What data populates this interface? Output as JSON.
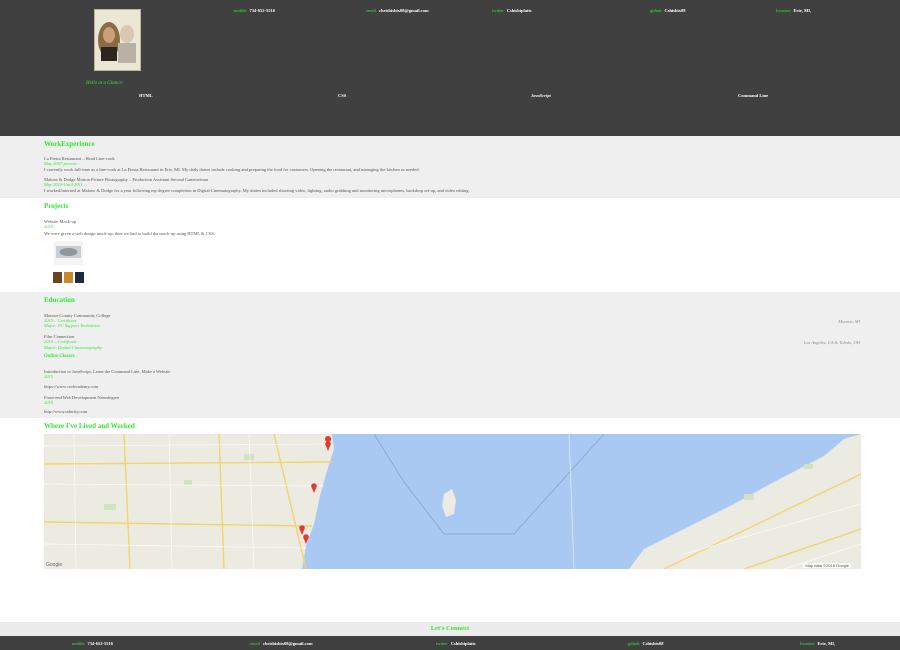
{
  "header": {
    "contacts": [
      {
        "label": "mobile",
        "value": "734-652-5516"
      },
      {
        "label": "email",
        "value": "chrisbishix08@gmail.com"
      },
      {
        "label": "twitter",
        "value": "Cshisbiplatis"
      },
      {
        "label": "github",
        "value": "Cshishix08"
      },
      {
        "label": "location",
        "value": "Erie, MI,"
      }
    ],
    "hello": "Hello at a Glance:",
    "skills": [
      "HTML",
      "CSS",
      "JavaScript",
      "Command Line"
    ]
  },
  "work": {
    "title": "WorkExperience",
    "jobs": [
      {
        "role": "La Fiesta Restaurant – Head Line-cook",
        "dates": "May 2007-present",
        "desc": "I currently work full-time as a line-cook at La Fiesta Restaurant in Erie, MI. My daily duties include cooking and preparing the food for customers. Opening the restaurant, and managing the kitchen as needed."
      },
      {
        "role": "Malone & Dodge Motion Picture Photography – Production Assistant Second Camera/man",
        "dates": "May 2010-Until 2011",
        "desc": "I worked/interned at Malone & Dodge for a year following my degree completion in Digital Cinematography. My duties included shooting video, lighting, audio grabbing and monitoring microphones, backdrop set-up, and video editing."
      }
    ]
  },
  "projects": {
    "title": "Projects",
    "name": "Website Mock-up",
    "year": "2015",
    "desc": "We were given a web design mock-up, then we had to build the mock-up using HTML & CSS."
  },
  "education": {
    "title": "Education",
    "schools": [
      {
        "name": "Monroe County Community College",
        "dates": "2015 – Certificate",
        "major": "Major: PC Support Technician",
        "location": "Monroe, MI"
      },
      {
        "name": "Film Connection",
        "dates": "2010 – Certificate",
        "major": "Major: Digital Cinematography",
        "location": "Los Angeles, CA & Toledo, OH"
      }
    ],
    "online_title": "Online Classes",
    "online": [
      {
        "name": "Introduction to JavaScript, Learn the Command Line, Make a Website",
        "year": "2015",
        "url": "https://www.codecademy.com"
      },
      {
        "name": "Front-end Web Development Nanodegree",
        "year": "2015",
        "url": "http://www.udacity.com"
      }
    ]
  },
  "map": {
    "title": "Where I've Lived and Worked",
    "attribution_left": "Google",
    "attribution_right": "Map data ©2016 Google"
  },
  "footer": {
    "title": "Let's Connect",
    "contacts": [
      {
        "label": "mobile",
        "value": "734-652-5516"
      },
      {
        "label": "email",
        "value": "chrisbishix08@gmail.com"
      },
      {
        "label": "twitter",
        "value": "Cshisbiplatis"
      },
      {
        "label": "github",
        "value": "Cshishix08"
      },
      {
        "label": "location",
        "value": "Erie, MI,"
      }
    ]
  },
  "colors": {
    "accent": "#33e633",
    "header_bg": "#404040",
    "band_bg": "#efefef"
  }
}
